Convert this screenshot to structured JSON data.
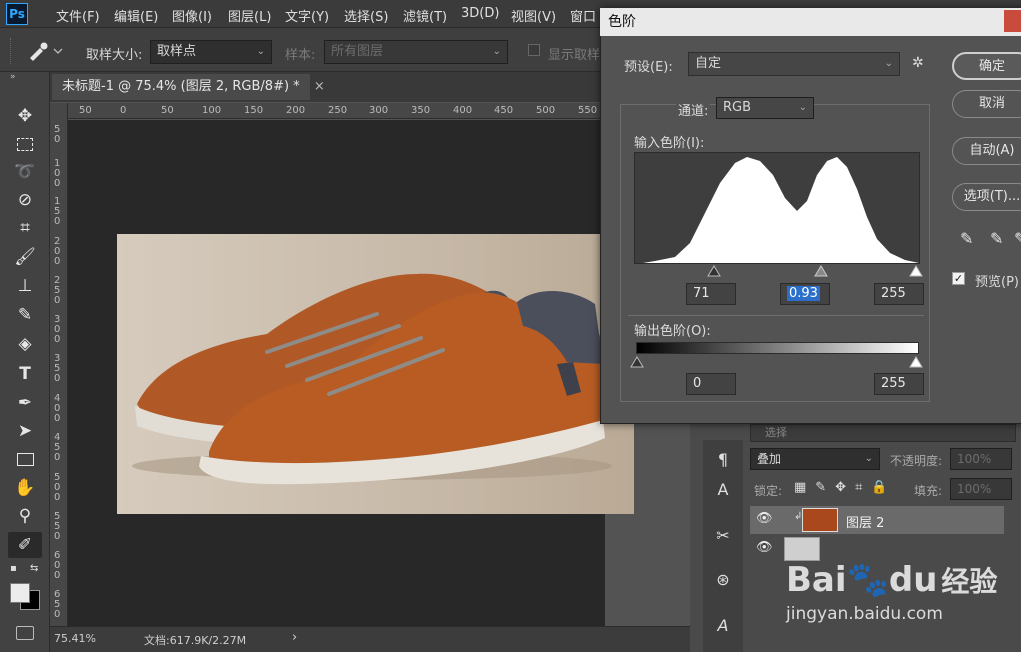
{
  "app": {
    "logo_text": "Ps",
    "menu": [
      "文件(F)",
      "编辑(E)",
      "图像(I)",
      "图层(L)",
      "文字(Y)",
      "选择(S)",
      "滤镜(T)",
      "3D(D)",
      "视图(V)",
      "窗口"
    ]
  },
  "options_bar": {
    "sample_size_label": "取样大小:",
    "sample_size_value": "取样点",
    "sample_label": "样本:",
    "sample_value": "所有图层",
    "show_ring_label": "显示取样"
  },
  "document": {
    "tab_title": "未标题-1 @ 75.4% (图层 2, RGB/8#) *",
    "close_glyph": "×",
    "ruler_h": [
      "50",
      "0",
      "50",
      "100",
      "150",
      "200",
      "250",
      "300",
      "350",
      "400",
      "450",
      "500",
      "550"
    ],
    "ruler_v": [
      "5 0",
      "1 0 0",
      "1 5 0",
      "2 0 0",
      "2 5 0",
      "3 0 0",
      "3 5 0",
      "4 0 0",
      "4 5 0",
      "5 0 0",
      "5 5 0",
      "6 0 0",
      "6 5 0"
    ]
  },
  "status": {
    "zoom": "75.41%",
    "doc_info": "文档:617.9K/2.27M",
    "arrow": "›"
  },
  "levels_dialog": {
    "title": "色阶",
    "preset_label": "预设(E):",
    "preset_value": "自定",
    "channel_label": "通道:",
    "channel_value": "RGB",
    "input_levels_label": "输入色阶(I):",
    "input_black": "71",
    "input_gamma": "0.93",
    "input_white": "255",
    "output_levels_label": "输出色阶(O):",
    "output_black": "0",
    "output_white": "255",
    "buttons": {
      "ok": "确定",
      "cancel": "取消",
      "auto": "自动(A)",
      "options": "选项(T)..."
    },
    "preview_label": "预览(P)",
    "preview_checked": true
  },
  "layers_panel": {
    "search_placeholder": "选择",
    "blend_mode": "叠加",
    "opacity_label": "不透明度:",
    "opacity_value": "100%",
    "lock_label": "锁定:",
    "fill_label": "填充:",
    "fill_value": "100%",
    "layers": [
      {
        "name": "图层 2",
        "visible": true,
        "selected": true
      },
      {
        "name": "",
        "visible": true,
        "selected": false
      }
    ]
  },
  "watermark": {
    "brand": "Bai",
    "brand2": "du",
    "cn": "经验",
    "url": "jingyan.baidu.com"
  }
}
